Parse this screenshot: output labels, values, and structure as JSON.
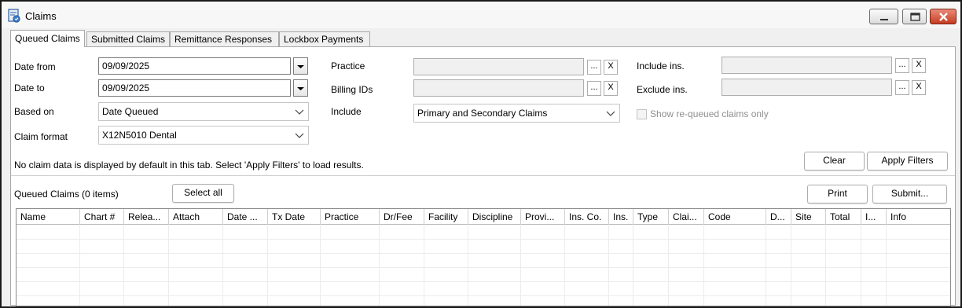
{
  "window": {
    "title": "Claims",
    "icon": "claims-app-icon",
    "controls": [
      "minimize-icon",
      "maximize-icon",
      "close-icon"
    ]
  },
  "tabs": [
    {
      "label": "Queued Claims",
      "active": true
    },
    {
      "label": "Submitted Claims",
      "active": false
    },
    {
      "label": "Remittance Responses",
      "active": false
    },
    {
      "label": "Lockbox Payments",
      "active": false
    }
  ],
  "filters": {
    "date_from": {
      "label": "Date from",
      "value": "09/09/2025"
    },
    "date_to": {
      "label": "Date to",
      "value": "09/09/2025"
    },
    "based_on": {
      "label": "Based on",
      "value": "Date Queued"
    },
    "claim_format": {
      "label": "Claim format",
      "value": "X12N5010 Dental"
    },
    "practice": {
      "label": "Practice",
      "value": ""
    },
    "billing_ids": {
      "label": "Billing IDs",
      "value": ""
    },
    "include": {
      "label": "Include",
      "value": "Primary and Secondary Claims"
    },
    "include_ins": {
      "label": "Include ins.",
      "value": ""
    },
    "exclude_ins": {
      "label": "Exclude ins.",
      "value": ""
    },
    "requeued_only": {
      "label": "Show re-queued claims only",
      "checked": false
    },
    "browse_label": "...",
    "clear_x_label": "X",
    "notice": "No claim data is displayed by default in this tab. Select 'Apply Filters' to load results.",
    "clear_button": "Clear",
    "apply_button": "Apply Filters"
  },
  "results": {
    "heading": "Queued Claims (0 items)",
    "select_all_button": "Select all",
    "print_button": "Print",
    "submit_button": "Submit...",
    "columns": [
      "Name",
      "Chart #",
      "Relea...",
      "Attach",
      "Date ...",
      "Tx Date",
      "Practice",
      "Dr/Fee",
      "Facility",
      "Discipline",
      "Provi...",
      "Ins. Co.",
      "Ins.",
      "Type",
      "Clai...",
      "Code",
      "D...",
      "Site",
      "Total",
      "I...",
      "Info"
    ],
    "rows": []
  }
}
